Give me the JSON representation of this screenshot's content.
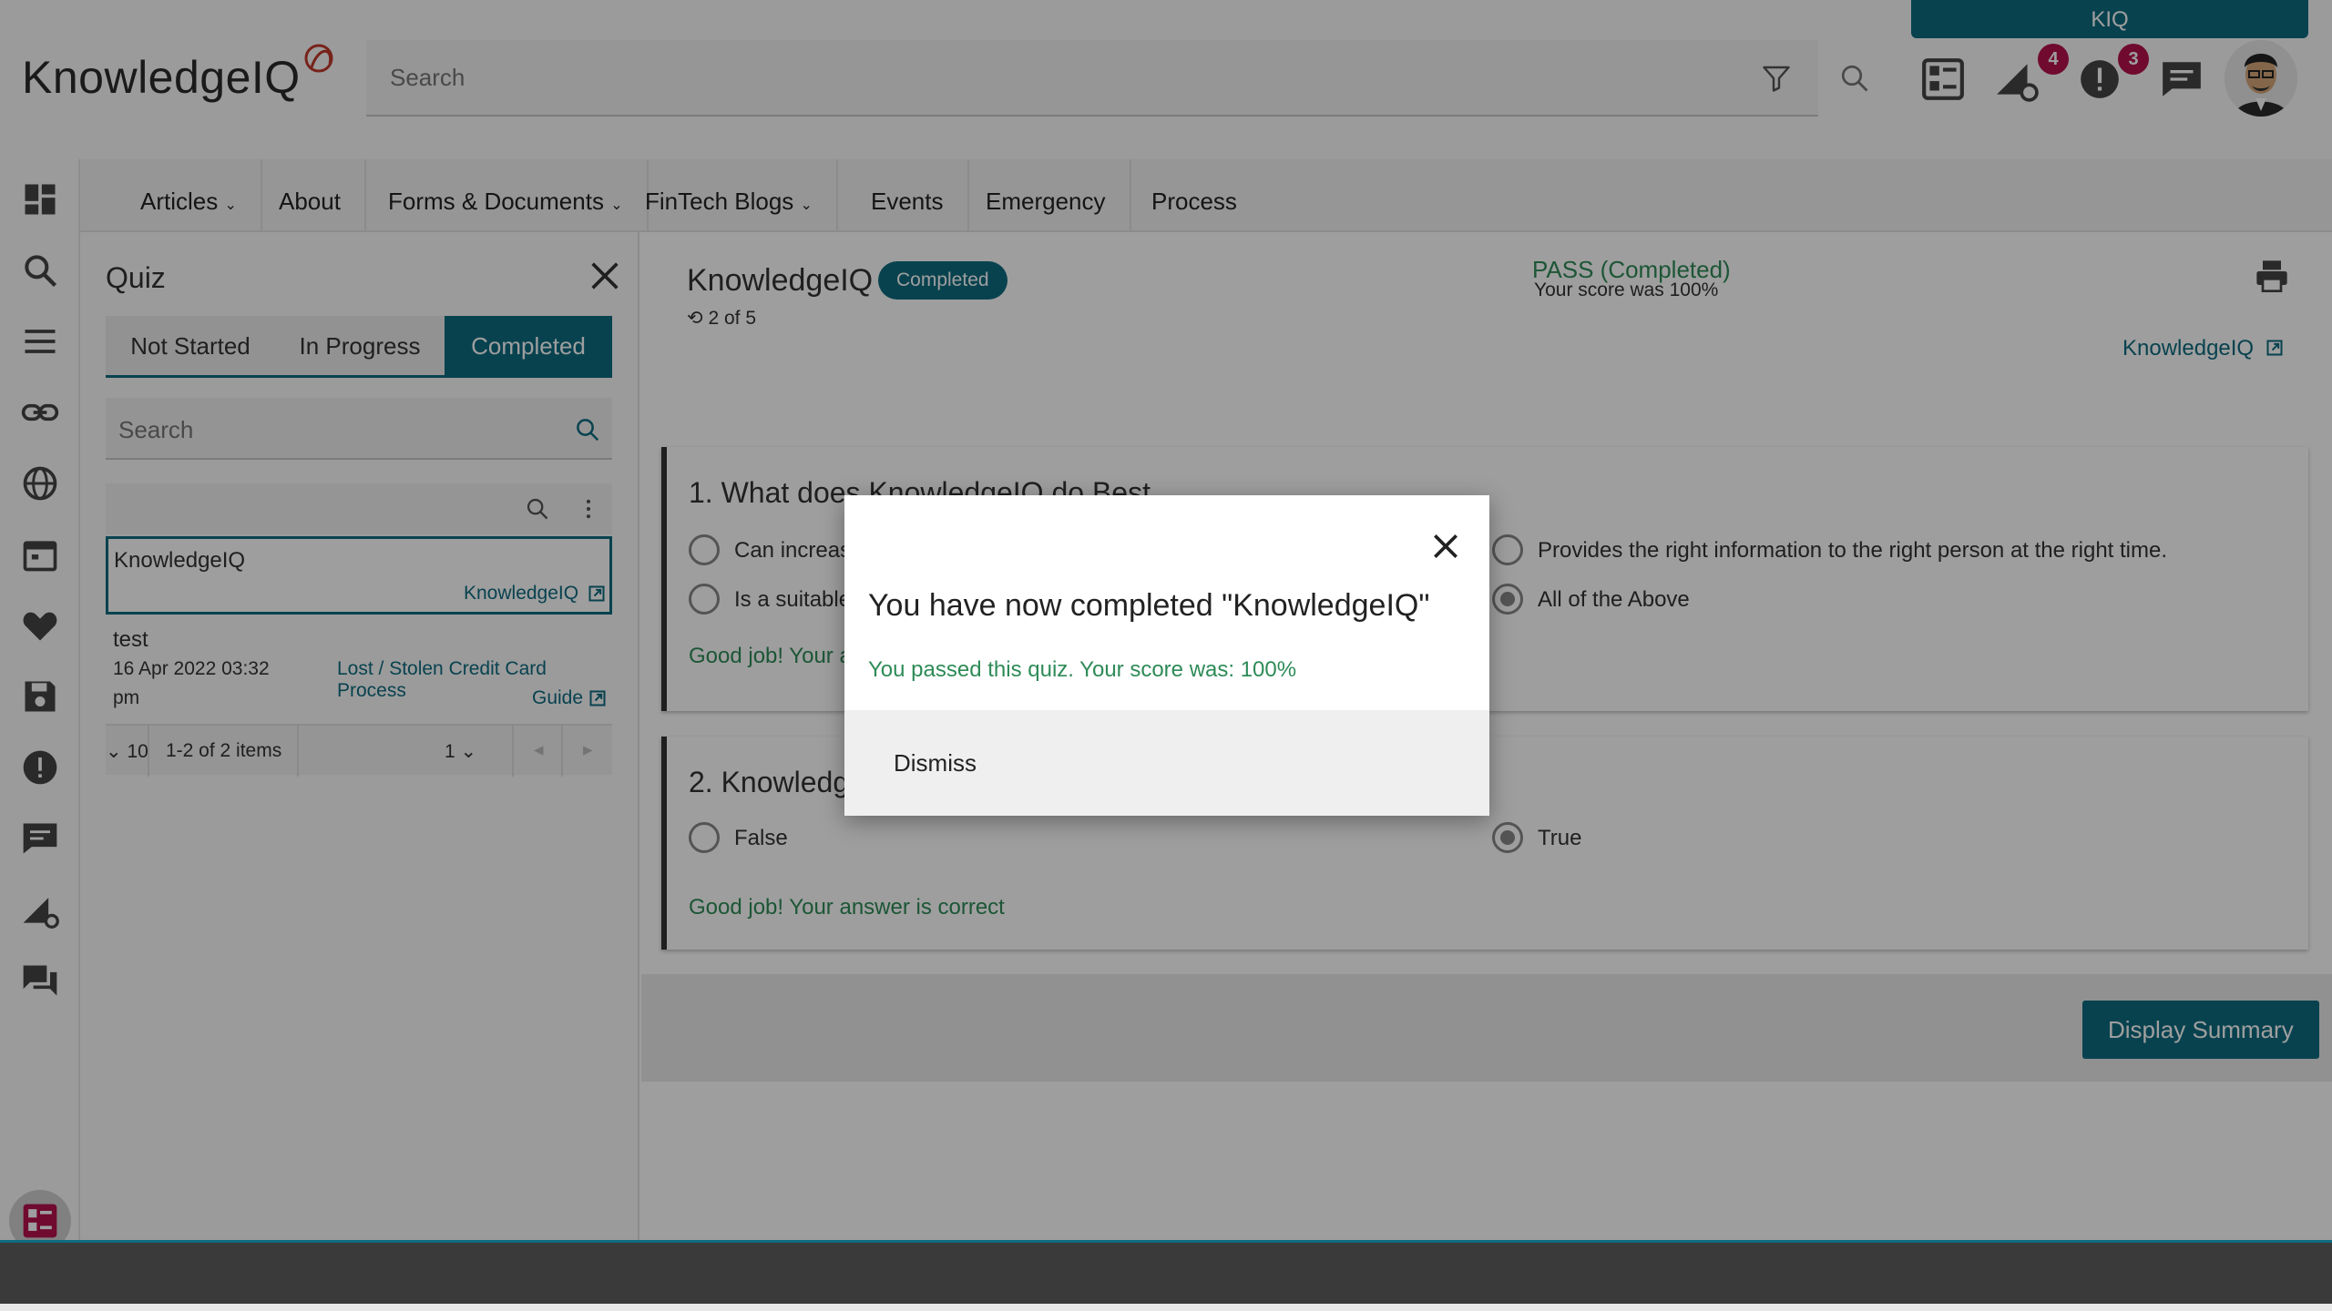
{
  "app": {
    "logo_text": "KnowledgeIQ",
    "kiq_tab": "KIQ",
    "search_placeholder": "Search",
    "badges": {
      "alerts_settings": "4",
      "notifications": "3"
    }
  },
  "nav": {
    "items": [
      {
        "label": "Articles",
        "has_dropdown": true
      },
      {
        "label": "About",
        "has_dropdown": false
      },
      {
        "label": "Forms & Documents",
        "has_dropdown": true
      },
      {
        "label": "FinTech Blogs",
        "has_dropdown": true
      },
      {
        "label": "Events",
        "has_dropdown": false
      },
      {
        "label": "Emergency",
        "has_dropdown": false
      },
      {
        "label": "Process",
        "has_dropdown": false
      }
    ]
  },
  "quiz_panel": {
    "title": "Quiz",
    "tabs": [
      "Not Started",
      "In Progress",
      "Completed"
    ],
    "active_tab": "Completed",
    "search_placeholder": "Search",
    "items": [
      {
        "title": "KnowledgeIQ",
        "link": "KnowledgeIQ"
      },
      {
        "title": "test",
        "date": "16 Apr 2022 03:32",
        "date_suffix": "pm",
        "link_line1": "Lost / Stolen Credit Card Process",
        "link_line2": "Guide"
      }
    ],
    "pager": {
      "page_size": "10",
      "range": "1-2 of 2 items",
      "page": "1"
    }
  },
  "main": {
    "quiz_name": "KnowledgeIQ",
    "status": "Completed",
    "attempt": "2 of 5",
    "pass_label": "PASS (Completed)",
    "score_label": "Your score was 100%",
    "kiq_link": "KnowledgeIQ",
    "questions": [
      {
        "title": "1. What does KnowledgeIQ do Best",
        "options": [
          {
            "label": "Can increas",
            "checked": false
          },
          {
            "label": "Provides the right information to the right person at the right time.",
            "checked": false
          },
          {
            "label": "Is a suitable",
            "checked": false
          },
          {
            "label": "All of the Above",
            "checked": true
          }
        ],
        "feedback": "Good job! Your a"
      },
      {
        "title": "2. Knowledg",
        "options": [
          {
            "label": "False",
            "checked": false
          },
          {
            "label": "True",
            "checked": true
          }
        ],
        "feedback": "Good job! Your answer is correct"
      }
    ],
    "summary_button": "Display Summary"
  },
  "modal": {
    "title": "You have now completed \"KnowledgeIQ\"",
    "message": "You passed this quiz. Your score was: 100%",
    "dismiss": "Dismiss"
  },
  "colors": {
    "accent": "#0e6b80",
    "badge": "#b5114d",
    "success": "#2e8b57",
    "rail_active_icon": "#b5114d"
  }
}
